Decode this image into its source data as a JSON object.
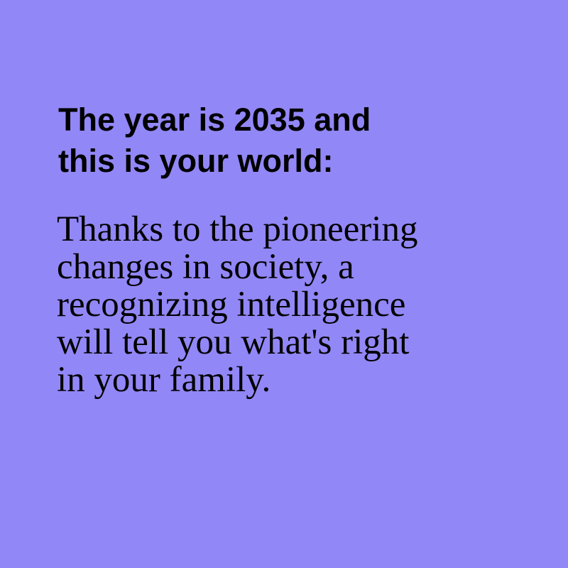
{
  "colors": {
    "background": "#9287f6",
    "text": "#000000"
  },
  "heading": "The year is 2035 and\nthis is your world:",
  "body": "Thanks to the pioneering\nchanges in society, a\nrecognizing intelligence\nwill tell you what's right\nin your family."
}
